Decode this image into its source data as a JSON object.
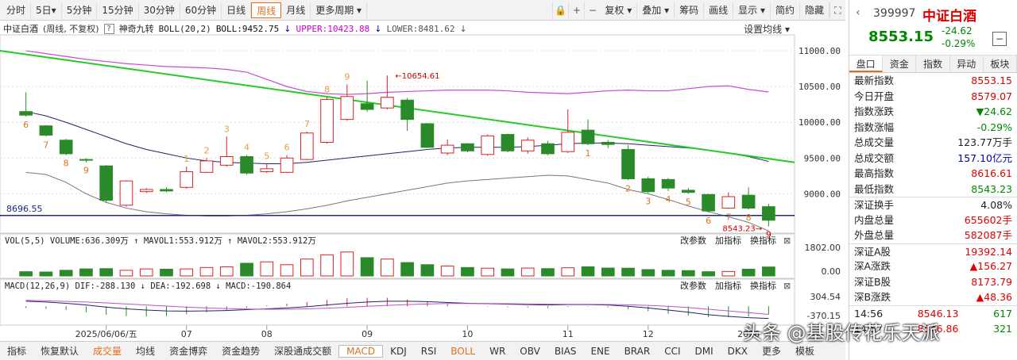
{
  "toolbar": {
    "periods": [
      "分时",
      "5日▾",
      "5分钟",
      "15分钟",
      "30分钟",
      "60分钟",
      "日线",
      "周线",
      "月线",
      "更多周期 ▾"
    ],
    "active_period": "周线",
    "tools": [
      "复权 ▾",
      "叠加 ▾",
      "筹码",
      "画线",
      "显示 ▾",
      "简约",
      "隐藏"
    ],
    "icons": [
      "lock-icon",
      "plus-icon",
      "minus-icon",
      "fullscreen-icon"
    ]
  },
  "main_info": {
    "name": "中证白酒",
    "subtitle": "(周线, 不复权)",
    "indicator": "神奇九转",
    "boll": "BOLL(20,2)",
    "boll_mid": "BOLL:9452.75",
    "upper": "UPPER:10423.88",
    "lower": "LOWER:8481.62",
    "ma_setting": "设置均线 ▾"
  },
  "price_axis": [
    "11000.00",
    "10500.00",
    "10000.00",
    "9500.00",
    "9000.00"
  ],
  "annotations": {
    "hline": "8696.55",
    "high": "10654.61",
    "low": "8543.23"
  },
  "vol_info": {
    "label": "VOL(5,5)",
    "volume": "VOLUME:636.309万",
    "mavol1": "MAVOL1:553.912万",
    "mavol2": "MAVOL2:553.912万",
    "axis": [
      "1802.00",
      "0.00"
    ]
  },
  "macd_info": {
    "label": "MACD(12,26,9)",
    "dif": "DIF:-288.130",
    "dea": "DEA:-192.698",
    "macd": "MACD:-190.864",
    "axis": [
      "304.54",
      "-370.15"
    ]
  },
  "panel_buttons": [
    "改参数",
    "加指标",
    "换指标"
  ],
  "date_axis": [
    "2025/06/06/五",
    "07",
    "08",
    "09",
    "10",
    "11",
    "12",
    "2026"
  ],
  "bottom_tabs": [
    "指标",
    "恢复默认",
    "成交量",
    "均线",
    "资金博弈",
    "资金趋势",
    "深股通成交额",
    "MACD",
    "KDJ",
    "RSI",
    "BOLL",
    "WR",
    "OBV",
    "BIAS",
    "ENE",
    "BRAR",
    "CCI",
    "DMI",
    "DKX",
    "更多",
    "模板"
  ],
  "active_tab": "MACD",
  "quote": {
    "code": "399997",
    "name": "中证白酒",
    "price": "8553.15",
    "change": "-24.62",
    "pct": "-0.29%"
  },
  "right_tabs": [
    "盘口",
    "资金",
    "指数",
    "异动",
    "板块"
  ],
  "stats": [
    {
      "k": "最新指数",
      "v": "8553.15",
      "c": "#d00"
    },
    {
      "k": "今日开盘",
      "v": "8579.07",
      "c": "#d00"
    },
    {
      "k": "指数涨跌",
      "v": "▼24.62",
      "c": "#080"
    },
    {
      "k": "指数涨幅",
      "v": "-0.29%",
      "c": "#080"
    },
    {
      "k": "总成交量",
      "v": "123.77万手",
      "c": "#222"
    },
    {
      "k": "总成交额",
      "v": "157.10亿元",
      "c": "#00a"
    },
    {
      "k": "最高指数",
      "v": "8616.61",
      "c": "#d00"
    },
    {
      "k": "最低指数",
      "v": "8543.23",
      "c": "#080"
    },
    {
      "k": "深证换手",
      "v": "4.08%",
      "c": "#222"
    },
    {
      "k": "内盘总量",
      "v": "655602手",
      "c": "#d00"
    },
    {
      "k": "外盘总量",
      "v": "582087手",
      "c": "#d00"
    },
    {
      "k": "深证A股",
      "v": "19392.14",
      "c": "#d00"
    },
    {
      "k": "深A涨跌",
      "v": "▲156.27",
      "c": "#d00"
    },
    {
      "k": "深证B股",
      "v": "8173.79",
      "c": "#d00"
    },
    {
      "k": "深B涨跌",
      "v": "▲48.36",
      "c": "#d00"
    }
  ],
  "ticks": [
    {
      "t": "14:56",
      "p": "8546.13",
      "v": "617"
    },
    {
      "t": "14:57",
      "p": "8546.86",
      "v": "321"
    }
  ],
  "watermark": "头条 @基股传花乐天派",
  "chart_data": {
    "type": "candlestick",
    "candles": [
      {
        "o": 10150,
        "c": 10100,
        "h": 10420,
        "l": 10080
      },
      {
        "o": 9950,
        "c": 9820,
        "h": 9960,
        "l": 9800
      },
      {
        "o": 9750,
        "c": 9560,
        "h": 9770,
        "l": 9540
      },
      {
        "o": 9480,
        "c": 9470,
        "h": 9500,
        "l": 9440
      },
      {
        "o": 9390,
        "c": 8910,
        "h": 9400,
        "l": 8880
      },
      {
        "o": 8840,
        "c": 9180,
        "h": 9190,
        "l": 8820
      },
      {
        "o": 9030,
        "c": 9060,
        "h": 9080,
        "l": 9010
      },
      {
        "o": 9060,
        "c": 9040,
        "h": 9090,
        "l": 9020
      },
      {
        "o": 9090,
        "c": 9310,
        "h": 9380,
        "l": 9070
      },
      {
        "o": 9300,
        "c": 9460,
        "h": 9500,
        "l": 9290
      },
      {
        "o": 9400,
        "c": 9520,
        "h": 9800,
        "l": 9380
      },
      {
        "o": 9520,
        "c": 9290,
        "h": 9540,
        "l": 9270
      },
      {
        "o": 9310,
        "c": 9350,
        "h": 9420,
        "l": 9290
      },
      {
        "o": 9300,
        "c": 9500,
        "h": 9540,
        "l": 9290
      },
      {
        "o": 9480,
        "c": 9850,
        "h": 9870,
        "l": 9470
      },
      {
        "o": 9720,
        "c": 10320,
        "h": 10350,
        "l": 9700
      },
      {
        "o": 10040,
        "c": 10360,
        "h": 10530,
        "l": 10020
      },
      {
        "o": 10260,
        "c": 10180,
        "h": 10580,
        "l": 10150
      },
      {
        "o": 10200,
        "c": 10350,
        "h": 10654.61,
        "l": 10180
      },
      {
        "o": 10310,
        "c": 10040,
        "h": 10340,
        "l": 9880
      },
      {
        "o": 9980,
        "c": 9650,
        "h": 9990,
        "l": 9640
      },
      {
        "o": 9570,
        "c": 9680,
        "h": 9760,
        "l": 9540
      },
      {
        "o": 9700,
        "c": 9600,
        "h": 9710,
        "l": 9580
      },
      {
        "o": 9550,
        "c": 9810,
        "h": 9830,
        "l": 9530
      },
      {
        "o": 9830,
        "c": 9600,
        "h": 9840,
        "l": 9580
      },
      {
        "o": 9600,
        "c": 9750,
        "h": 9790,
        "l": 9560
      },
      {
        "o": 9700,
        "c": 9560,
        "h": 9740,
        "l": 9540
      },
      {
        "o": 9590,
        "c": 9860,
        "h": 10180,
        "l": 9570
      },
      {
        "o": 9890,
        "c": 9700,
        "h": 10040,
        "l": 9680
      },
      {
        "o": 9720,
        "c": 9690,
        "h": 9750,
        "l": 9640
      },
      {
        "o": 9620,
        "c": 9210,
        "h": 9680,
        "l": 9190
      },
      {
        "o": 9210,
        "c": 9030,
        "h": 9240,
        "l": 9010
      },
      {
        "o": 9200,
        "c": 9080,
        "h": 9220,
        "l": 9040
      },
      {
        "o": 9050,
        "c": 9020,
        "h": 9080,
        "l": 9000
      },
      {
        "o": 8990,
        "c": 8760,
        "h": 9000,
        "l": 8740
      },
      {
        "o": 8800,
        "c": 8960,
        "h": 9020,
        "l": 8790
      },
      {
        "o": 8980,
        "c": 8800,
        "h": 9090,
        "l": 8780
      },
      {
        "o": 8820,
        "c": 8630,
        "h": 8860,
        "l": 8543.23
      }
    ],
    "volumes": [
      300,
      280,
      400,
      500,
      520,
      400,
      500,
      480,
      500,
      600,
      650,
      900,
      1000,
      800,
      1200,
      1500,
      1700,
      1300,
      1200,
      950,
      800,
      700,
      600,
      550,
      500,
      560,
      520,
      580,
      650,
      560,
      550,
      450,
      400,
      380,
      300,
      320,
      480,
      636
    ],
    "td_counts": [
      {
        "i": 0,
        "n": "6"
      },
      {
        "i": 1,
        "n": "7"
      },
      {
        "i": 2,
        "n": "8"
      },
      {
        "i": 3,
        "n": "9"
      },
      {
        "i": 8,
        "n": "1"
      },
      {
        "i": 9,
        "n": "2"
      },
      {
        "i": 10,
        "n": "3"
      },
      {
        "i": 11,
        "n": "4"
      },
      {
        "i": 12,
        "n": "5"
      },
      {
        "i": 13,
        "n": "6"
      },
      {
        "i": 14,
        "n": "7"
      },
      {
        "i": 15,
        "n": "8"
      },
      {
        "i": 16,
        "n": "9"
      },
      {
        "i": 28,
        "n": "1"
      },
      {
        "i": 30,
        "n": "2"
      },
      {
        "i": 31,
        "n": "3"
      },
      {
        "i": 32,
        "n": "4"
      },
      {
        "i": 33,
        "n": "5"
      },
      {
        "i": 34,
        "n": "6"
      },
      {
        "i": 35,
        "n": "7"
      },
      {
        "i": 36,
        "n": "8"
      },
      {
        "i": 37,
        "n": "9"
      }
    ],
    "ylim": [
      8450,
      11200
    ],
    "boll_upper": [
      11000,
      10960,
      10920,
      10880,
      10850,
      10820,
      10800,
      10780,
      10770,
      10760,
      10740,
      10700,
      10600,
      10500,
      10430,
      10400,
      10390,
      10400,
      10420,
      10430,
      10440,
      10450,
      10450,
      10450,
      10440,
      10420,
      10410,
      10400,
      10420,
      10440,
      10450,
      10440,
      10440,
      10470,
      10500,
      10510,
      10460,
      10423.88
    ],
    "boll_mid": [
      10150,
      10090,
      10000,
      9900,
      9800,
      9700,
      9620,
      9560,
      9500,
      9460,
      9440,
      9430,
      9420,
      9420,
      9440,
      9470,
      9500,
      9530,
      9560,
      9590,
      9620,
      9640,
      9650,
      9650,
      9650,
      9660,
      9680,
      9700,
      9710,
      9710,
      9700,
      9680,
      9660,
      9640,
      9610,
      9570,
      9520,
      9452.75
    ],
    "boll_lower": [
      9300,
      9270,
      9160,
      9000,
      8880,
      8800,
      8750,
      8720,
      8700,
      8690,
      8690,
      8700,
      8720,
      8750,
      8790,
      8840,
      8900,
      8950,
      9000,
      9050,
      9100,
      9150,
      9180,
      9200,
      9220,
      9240,
      9260,
      9250,
      9200,
      9150,
      9060,
      9000,
      8920,
      8830,
      8750,
      8680,
      8600,
      8481.62
    ],
    "trendline": [
      11000,
      9440
    ],
    "hline": 8696.55,
    "macd_dif": [
      120,
      100,
      70,
      30,
      -20,
      -60,
      -90,
      -110,
      -115,
      -110,
      -100,
      -80,
      -60,
      -40,
      -10,
      30,
      70,
      100,
      120,
      120,
      110,
      90,
      70,
      60,
      50,
      40,
      30,
      40,
      40,
      30,
      0,
      -40,
      -90,
      -140,
      -200,
      -240,
      -270,
      -288.13
    ],
    "macd_dea": [
      140,
      130,
      115,
      100,
      80,
      55,
      30,
      5,
      -20,
      -40,
      -55,
      -65,
      -70,
      -70,
      -60,
      -45,
      -25,
      0,
      20,
      40,
      55,
      65,
      65,
      65,
      60,
      55,
      50,
      48,
      46,
      43,
      35,
      20,
      0,
      -30,
      -70,
      -110,
      -150,
      -192.698
    ]
  }
}
